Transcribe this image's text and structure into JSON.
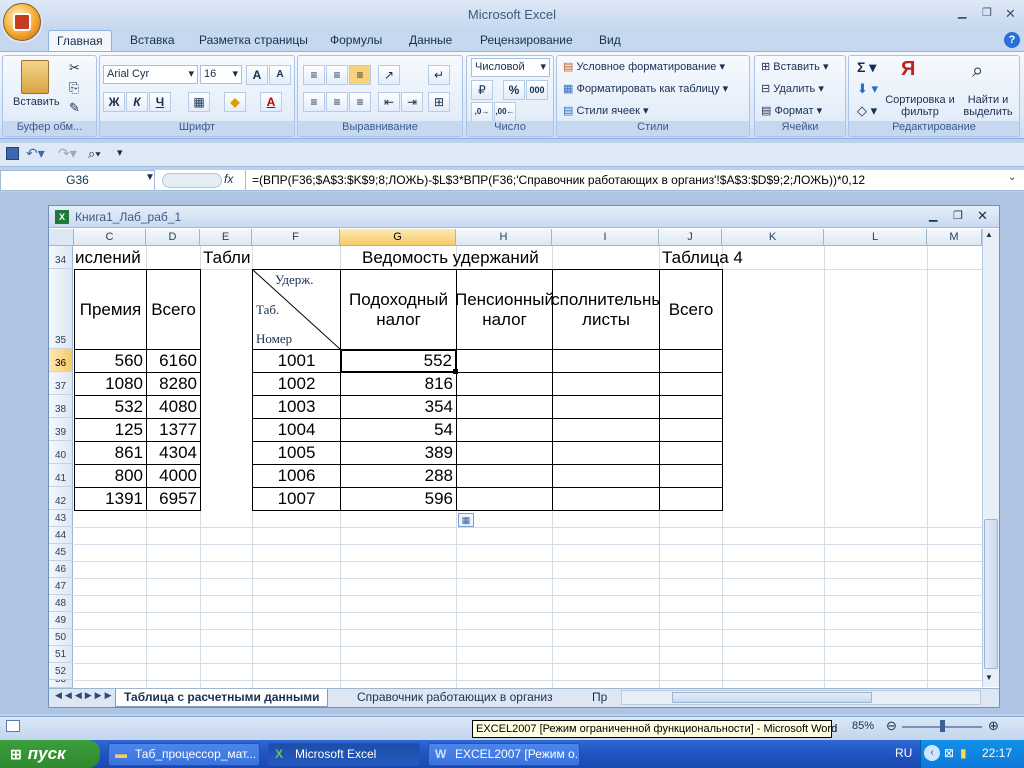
{
  "app": {
    "title": "Microsoft Excel"
  },
  "ribbon_tabs": [
    "Главная",
    "Вставка",
    "Разметка страницы",
    "Формулы",
    "Данные",
    "Рецензирование",
    "Вид"
  ],
  "ribbon": {
    "clipboard": {
      "paste": "Вставить",
      "label": "Буфер обм..."
    },
    "font": {
      "name": "Arial Cyr",
      "size": "16",
      "bold": "Ж",
      "italic": "К",
      "underline": "Ч",
      "label": "Шрифт"
    },
    "alignment": {
      "label": "Выравнивание"
    },
    "number": {
      "format": "Числовой",
      "percent": "%",
      "thousands": "000",
      "label": "Число"
    },
    "styles": {
      "conditional": "Условное форматирование",
      "as_table": "Форматировать как таблицу",
      "cell_styles": "Стили ячеек",
      "label": "Стили"
    },
    "cells": {
      "insert": "Вставить",
      "delete": "Удалить",
      "format": "Формат",
      "label": "Ячейки"
    },
    "editing": {
      "sort": "Сортировка и фильтр",
      "find": "Найти и выделить",
      "label": "Редактирование"
    }
  },
  "formula_bar": {
    "name_box": "G36",
    "fx": "fx",
    "formula": "=(ВПР(F36;$A$3:$K$9;8;ЛОЖЬ)-$L$3*ВПР(F36;'Справочник работающих в организ'!$A$3:$D$9;2;ЛОЖЬ))*0,12"
  },
  "workbook": {
    "title": "Книга1_Лаб_раб_1"
  },
  "columns": [
    "C",
    "D",
    "E",
    "F",
    "G",
    "H",
    "I",
    "J",
    "K",
    "L",
    "M"
  ],
  "rows": [
    "34",
    "35",
    "36",
    "37",
    "38",
    "39",
    "40",
    "41",
    "42",
    "43",
    "44",
    "45",
    "46",
    "47",
    "48",
    "49",
    "50",
    "51",
    "52",
    "53"
  ],
  "sheet": {
    "r34_left": "ислений",
    "r34_e": "Таблиц",
    "r34_title": "Ведомость удержаний",
    "r34_j": "Таблица 4",
    "header_c": "Премия",
    "header_d": "Всего",
    "header_f_top": "Удерж.",
    "header_f_mid": "Таб.",
    "header_f_bot": "Номер",
    "header_g": "Подоходный налог",
    "header_h": "Пенсионный налог",
    "header_i": "Исполнительные листы",
    "header_j": "Всего",
    "data": [
      {
        "c": "560",
        "d": "6160",
        "f": "1001",
        "g": "552"
      },
      {
        "c": "1080",
        "d": "8280",
        "f": "1002",
        "g": "816"
      },
      {
        "c": "532",
        "d": "4080",
        "f": "1003",
        "g": "354"
      },
      {
        "c": "125",
        "d": "1377",
        "f": "1004",
        "g": "54"
      },
      {
        "c": "861",
        "d": "4304",
        "f": "1005",
        "g": "389"
      },
      {
        "c": "800",
        "d": "4000",
        "f": "1006",
        "g": "288"
      },
      {
        "c": "1391",
        "d": "6957",
        "f": "1007",
        "g": "596"
      }
    ]
  },
  "sheet_tabs": [
    "Таблица с расчетными данными",
    "Справочник работающих в организ",
    "Пр"
  ],
  "status": {
    "zoom": "85%"
  },
  "tooltip": "EXCEL2007 [Режим ограниченной функциональности] - Microsoft Word",
  "taskbar": {
    "start": "пуск",
    "items": [
      "Таб_процессор_мат...",
      "Microsoft Excel",
      "EXCEL2007 [Режим о..."
    ],
    "lang": "RU",
    "clock": "22:17"
  }
}
